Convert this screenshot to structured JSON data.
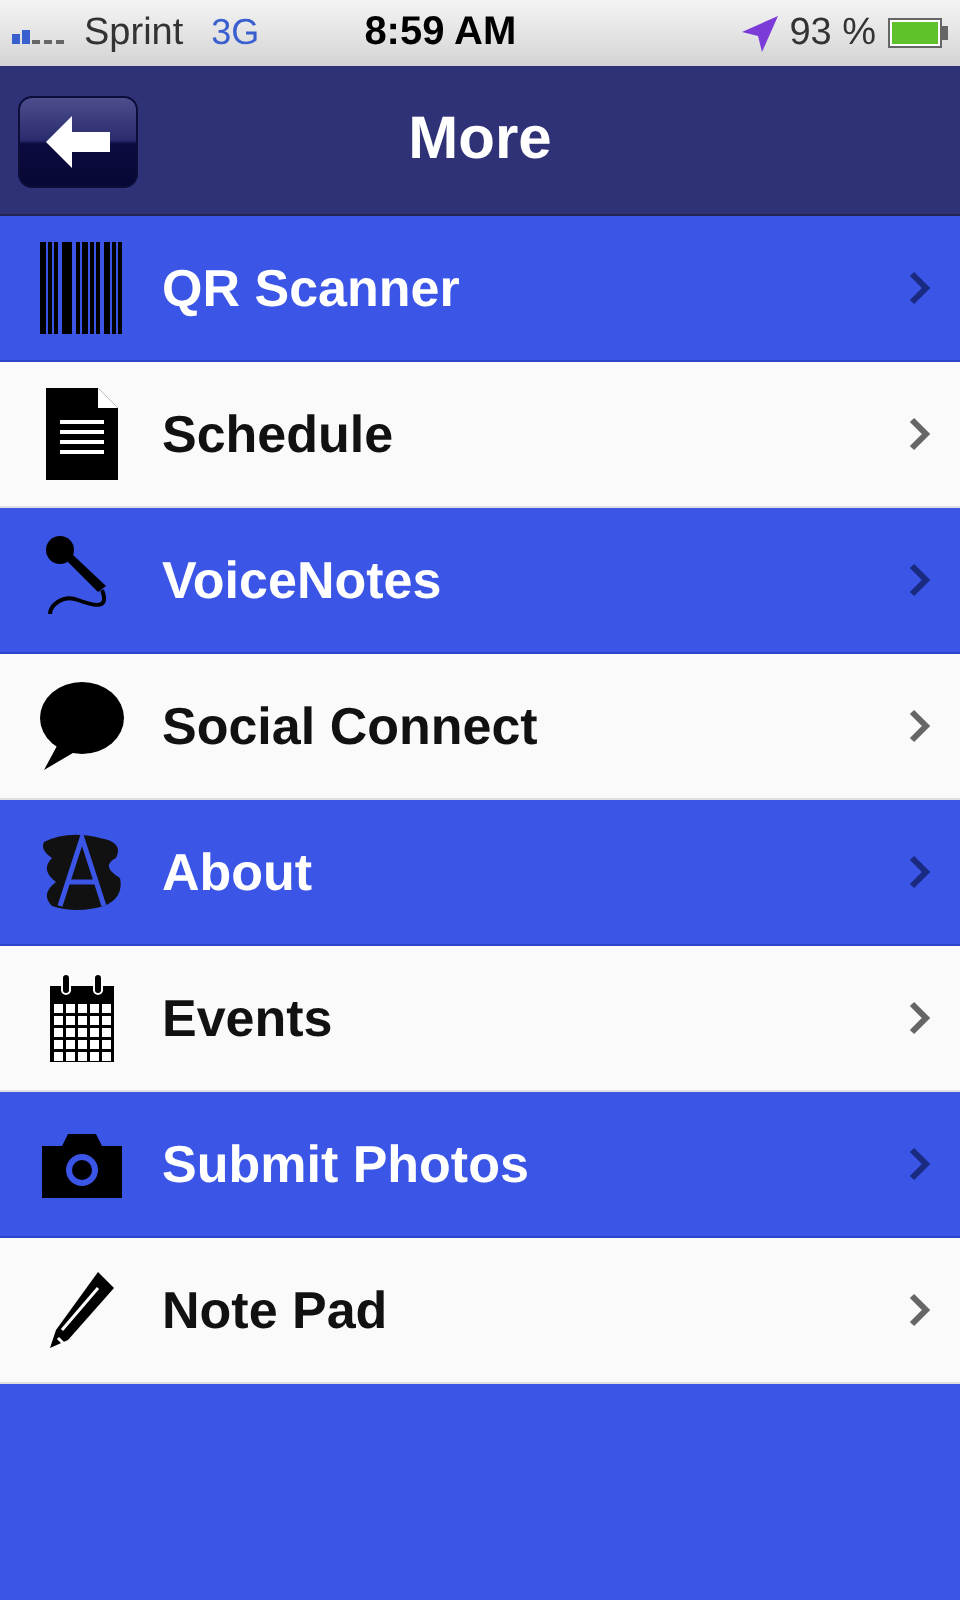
{
  "status_bar": {
    "carrier": "Sprint",
    "network": "3G",
    "time": "8:59 AM",
    "battery": "93 %"
  },
  "nav_bar": {
    "title": "More"
  },
  "menu": [
    {
      "label": "QR Scanner",
      "shaded": true
    },
    {
      "label": "Schedule",
      "shaded": false
    },
    {
      "label": "VoiceNotes",
      "shaded": true
    },
    {
      "label": "Social Connect",
      "shaded": false
    },
    {
      "label": "About",
      "shaded": true
    },
    {
      "label": "Events",
      "shaded": false
    },
    {
      "label": "Submit Photos",
      "shaded": true
    },
    {
      "label": "Note Pad",
      "shaded": false
    }
  ]
}
